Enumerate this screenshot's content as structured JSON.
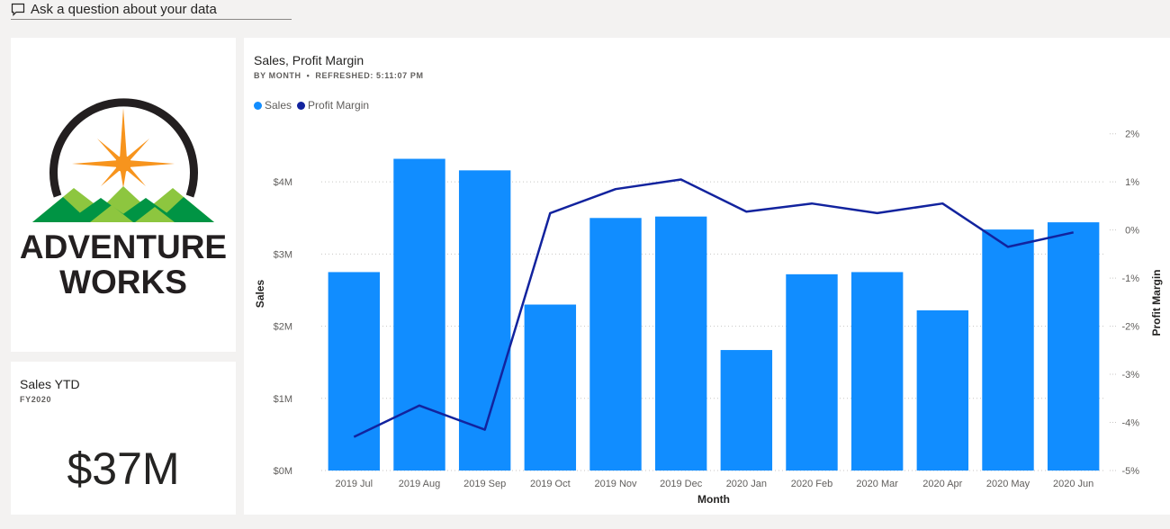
{
  "qa": {
    "label": "Ask a question about your data"
  },
  "logo": {
    "line1": "ADVENTURE",
    "line2": "WORKS",
    "colors": {
      "ring": "#231f20",
      "star": "#f7941d",
      "mountain_dark": "#009444",
      "mountain_light": "#8dc63f",
      "text": "#231f20"
    }
  },
  "kpi": {
    "title": "Sales YTD",
    "subtitle": "FY2020",
    "value": "$37M"
  },
  "chart": {
    "title": "Sales, Profit Margin",
    "subtitle_left": "BY MONTH",
    "subtitle_sep": "•",
    "subtitle_right": "REFRESHED: 5:11:07 PM",
    "legend": [
      {
        "label": "Sales",
        "color": "#118dff"
      },
      {
        "label": "Profit Margin",
        "color": "#12239e"
      }
    ]
  },
  "chart_data": {
    "type": "bar",
    "categories": [
      "2019 Jul",
      "2019 Aug",
      "2019 Sep",
      "2019 Oct",
      "2019 Nov",
      "2019 Dec",
      "2020 Jan",
      "2020 Feb",
      "2020 Mar",
      "2020 Apr",
      "2020 May",
      "2020 Jun"
    ],
    "series": [
      {
        "name": "Sales",
        "type": "bar",
        "axis": "left",
        "color": "#118dff",
        "values": [
          2.75,
          4.32,
          4.16,
          2.3,
          3.5,
          3.52,
          1.67,
          2.72,
          2.75,
          2.22,
          3.34,
          3.44
        ]
      },
      {
        "name": "Profit Margin",
        "type": "line",
        "axis": "right",
        "color": "#12239e",
        "values": [
          -4.3,
          -3.65,
          -4.15,
          0.35,
          0.85,
          1.05,
          0.38,
          0.55,
          0.35,
          0.55,
          -0.35,
          -0.05
        ]
      }
    ],
    "xlabel": "Month",
    "ylabel": "Sales",
    "y2label": "Profit Margin",
    "ylim": [
      0,
      4.9
    ],
    "y2lim": [
      -5,
      2.35
    ],
    "yticks": [
      0,
      1,
      2,
      3,
      4
    ],
    "yticklabels": [
      "$0M",
      "$1M",
      "$2M",
      "$3M",
      "$4M"
    ],
    "y2ticks": [
      -5,
      -4,
      -3,
      -2,
      -1,
      0,
      1,
      2
    ],
    "y2ticklabels": [
      "-5%",
      "-4%",
      "-3%",
      "-2%",
      "-1%",
      "0%",
      "1%",
      "2%"
    ],
    "grid": true
  }
}
